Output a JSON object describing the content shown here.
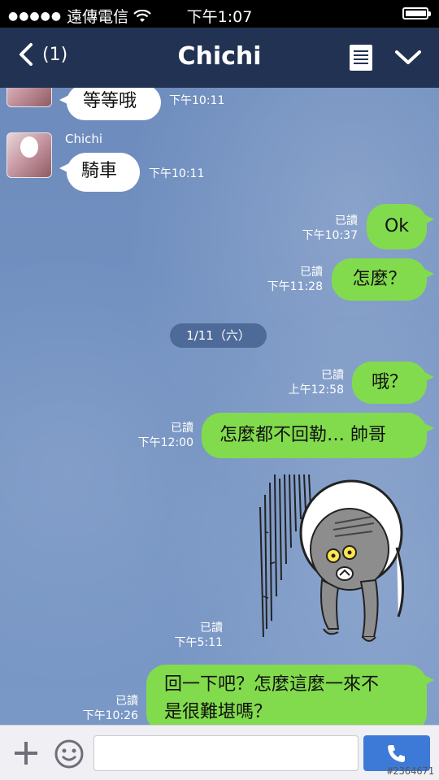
{
  "status_bar": {
    "signal_dots": "●●●●●",
    "carrier": "遠傳電信",
    "time": "下午1:07",
    "battery_level": 0.9
  },
  "nav": {
    "back_icon": "chevron-left-icon",
    "unread": "(1)",
    "title": "Chichi",
    "note_icon": "note-icon",
    "menu_icon": "chevron-down-icon"
  },
  "chat": {
    "messages": [
      {
        "side": "in",
        "text": "等等哦",
        "time": "下午10:11"
      },
      {
        "side": "in",
        "sender": "Chichi",
        "text": "騎車",
        "time": "下午10:11"
      },
      {
        "side": "out",
        "read": "已讀",
        "time": "下午10:37",
        "text": "Ok"
      },
      {
        "side": "out",
        "read": "已讀",
        "time": "下午11:28",
        "text": "怎麼？"
      },
      {
        "side": "out",
        "read": "已讀",
        "time": "上午12:58",
        "text": "哦？"
      },
      {
        "side": "out",
        "read": "已讀",
        "time": "下午12:00",
        "text": "怎麼都不回勒… 帥哥"
      },
      {
        "side": "out",
        "read": "已讀",
        "time": "下午5:11",
        "sticker": "sad-bear-sticker"
      },
      {
        "side": "out",
        "read": "已讀",
        "time": "下午10:26",
        "lines": [
          "回一下吧？怎麼這麼一來不",
          "是很難堪嗎？"
        ]
      }
    ],
    "date_separator": "1/11（六）"
  },
  "input_bar": {
    "plus_icon": "plus-icon",
    "emoji_icon": "emoji-icon",
    "placeholder": "",
    "call_icon": "phone-icon"
  },
  "watermark": "#2364671",
  "colors": {
    "nav_bg": "#223252",
    "outgoing_bubble": "#82db4c",
    "incoming_bubble": "#ffffff",
    "chat_bg": "#6f8fbf",
    "call_button": "#3d7ad8"
  }
}
